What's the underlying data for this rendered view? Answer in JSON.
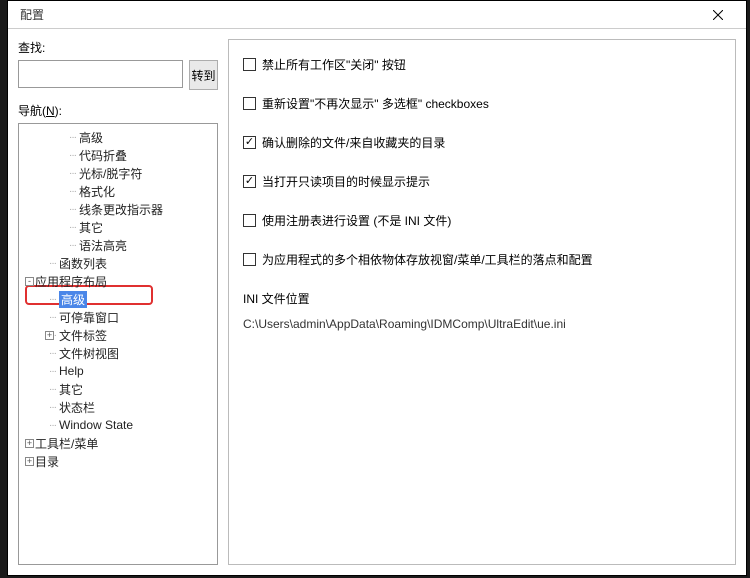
{
  "titlebar": {
    "title": "配置"
  },
  "left": {
    "search_label": "查找:",
    "go_btn": "转到",
    "nav_label_pre": "导航(",
    "nav_label_key": "N",
    "nav_label_post": "):",
    "tree": [
      {
        "lvl": 2,
        "label": "高级"
      },
      {
        "lvl": 2,
        "label": "代码折叠"
      },
      {
        "lvl": 2,
        "label": "光标/脱字符"
      },
      {
        "lvl": 2,
        "label": "格式化"
      },
      {
        "lvl": 2,
        "label": "线条更改指示器"
      },
      {
        "lvl": 2,
        "label": "其它"
      },
      {
        "lvl": 2,
        "label": "语法高亮"
      },
      {
        "lvl": 1,
        "label": "函数列表"
      },
      {
        "lvl": 0,
        "label": "应用程序布局",
        "toggle": "-"
      },
      {
        "lvl": 1,
        "label": "高级",
        "selected": true
      },
      {
        "lvl": 1,
        "label": "可停靠窗口"
      },
      {
        "lvl": 1,
        "label": "文件标签",
        "toggle": "+"
      },
      {
        "lvl": 1,
        "label": "文件树视图"
      },
      {
        "lvl": 1,
        "label": "Help"
      },
      {
        "lvl": 1,
        "label": "其它"
      },
      {
        "lvl": 1,
        "label": "状态栏"
      },
      {
        "lvl": 1,
        "label": "Window State"
      },
      {
        "lvl": 0,
        "label": "工具栏/菜单",
        "toggle": "+"
      },
      {
        "lvl": 0,
        "label": "目录",
        "toggle": "+"
      }
    ]
  },
  "right": {
    "checks": [
      {
        "checked": false,
        "label": "禁止所有工作区\"关闭\" 按钮"
      },
      {
        "checked": false,
        "label": "重新设置\"不再次显示\" 多选框\" checkboxes"
      },
      {
        "checked": true,
        "label": "确认删除的文件/来自收藏夹的目录"
      },
      {
        "checked": true,
        "label": "当打开只读项目的时候显示提示"
      },
      {
        "checked": false,
        "label": "使用注册表进行设置 (不是 INI 文件)"
      },
      {
        "checked": false,
        "label": "为应用程式的多个相依物体存放视窗/菜单/工具栏的落点和配置"
      }
    ],
    "ini_label": "INI 文件位置",
    "ini_path": "C:\\Users\\admin\\AppData\\Roaming\\IDMComp\\UltraEdit\\ue.ini"
  }
}
